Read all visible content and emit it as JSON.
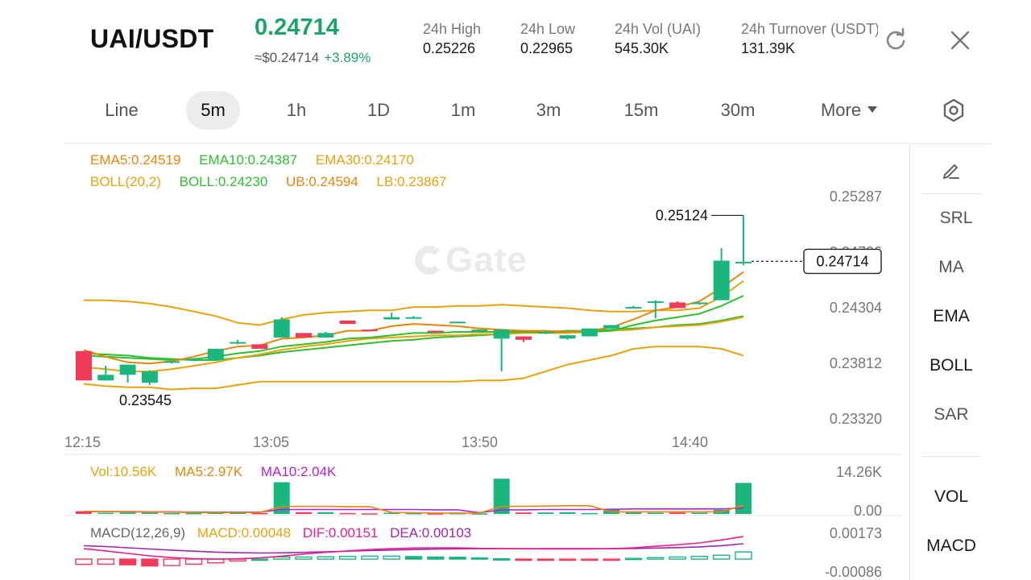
{
  "header": {
    "pair": "UAI/USDT",
    "price": "0.24714",
    "usd_price": "≈$0.24714",
    "change": "+3.89%",
    "stats": [
      {
        "label": "24h  High",
        "value": "0.25226"
      },
      {
        "label": "24h  Low",
        "value": "0.22965"
      },
      {
        "label": "24h  Vol (UAI)",
        "value": "545.30K"
      },
      {
        "label": "24h  Turnover (USDT)",
        "value": "131.39K"
      }
    ],
    "icons": {
      "refresh": "refresh-icon",
      "close": "close-icon"
    }
  },
  "tabs": {
    "items": [
      "Line",
      "5m",
      "1h",
      "1D",
      "1m",
      "3m",
      "15m",
      "30m",
      "More"
    ],
    "active": "5m",
    "settings_icon": "hexagon-settings-icon"
  },
  "legends": {
    "ema": {
      "ema5": "EMA5:0.24519",
      "ema10": "EMA10:0.24387",
      "ema30": "EMA30:0.24170"
    },
    "boll": {
      "params": "BOLL(20,2)",
      "mid": "BOLL:0.24230",
      "ub": "UB:0.24594",
      "lb": "LB:0.23867"
    },
    "vol": {
      "vol": "Vol:10.56K",
      "ma5": "MA5:2.97K",
      "ma10": "MA10:2.04K"
    },
    "macd": {
      "params": "MACD(12,26,9)",
      "macd": "MACD:0.00048",
      "dif": "DIF:0.00151",
      "dea": "DEA:0.00103"
    }
  },
  "side_toolbar": {
    "draw_icon": "pencil-icon",
    "items": [
      "SRL",
      "MA",
      "EMA",
      "BOLL",
      "SAR",
      "VOL",
      "MACD"
    ]
  },
  "watermark": "Gate",
  "colors": {
    "up": "#19b77e",
    "down": "#f23a5a",
    "ema5": "#e8860b",
    "ema10": "#2fbf2f",
    "ema30": "#e8a30b",
    "boll_mid": "#2fbf2f",
    "boll_band": "#e8a30b",
    "ma5": "#e8860b",
    "ma10": "#b620d6",
    "dif": "#e91e8c",
    "dea": "#9c27b0"
  },
  "chart_data": {
    "type": "candlestick",
    "y_ticks": [
      "0.25287",
      "0.24796",
      "0.24304",
      "0.23812",
      "0.23320"
    ],
    "x_ticks": [
      "12:15",
      "13:05",
      "13:50",
      "14:40"
    ],
    "ylim": [
      0.2332,
      0.25287
    ],
    "last_price": "0.24714",
    "high_label": "0.25124",
    "low_label": "0.23545",
    "candles": [
      {
        "o": 0.2392,
        "h": 0.2392,
        "l": 0.2366,
        "c": 0.2366
      },
      {
        "o": 0.2366,
        "h": 0.2379,
        "l": 0.2366,
        "c": 0.2371
      },
      {
        "o": 0.2371,
        "h": 0.238,
        "l": 0.2364,
        "c": 0.238
      },
      {
        "o": 0.2364,
        "h": 0.2375,
        "l": 0.2362,
        "c": 0.2374
      },
      {
        "o": 0.2382,
        "h": 0.2383,
        "l": 0.2381,
        "c": 0.2383
      },
      {
        "o": 0.2384,
        "h": 0.2385,
        "l": 0.2383,
        "c": 0.2385
      },
      {
        "o": 0.2384,
        "h": 0.2394,
        "l": 0.2384,
        "c": 0.2394
      },
      {
        "o": 0.24,
        "h": 0.2402,
        "l": 0.2398,
        "c": 0.24
      },
      {
        "o": 0.2398,
        "h": 0.2398,
        "l": 0.2394,
        "c": 0.2394
      },
      {
        "o": 0.2404,
        "h": 0.2422,
        "l": 0.2404,
        "c": 0.242
      },
      {
        "o": 0.2408,
        "h": 0.2408,
        "l": 0.2404,
        "c": 0.2404
      },
      {
        "o": 0.2404,
        "h": 0.2409,
        "l": 0.2404,
        "c": 0.2408
      },
      {
        "o": 0.2419,
        "h": 0.2419,
        "l": 0.2416,
        "c": 0.2416
      },
      {
        "o": 0.2411,
        "h": 0.2411,
        "l": 0.241,
        "c": 0.241
      },
      {
        "o": 0.242,
        "h": 0.2426,
        "l": 0.242,
        "c": 0.2422
      },
      {
        "o": 0.2422,
        "h": 0.2423,
        "l": 0.2421,
        "c": 0.2422
      },
      {
        "o": 0.241,
        "h": 0.241,
        "l": 0.2409,
        "c": 0.2409
      },
      {
        "o": 0.2418,
        "h": 0.2418,
        "l": 0.2417,
        "c": 0.2418
      },
      {
        "o": 0.2411,
        "h": 0.2411,
        "l": 0.241,
        "c": 0.2411
      },
      {
        "o": 0.2403,
        "h": 0.2411,
        "l": 0.2374,
        "c": 0.2411
      },
      {
        "o": 0.2405,
        "h": 0.2405,
        "l": 0.24,
        "c": 0.2402
      },
      {
        "o": 0.2408,
        "h": 0.241,
        "l": 0.2407,
        "c": 0.2409
      },
      {
        "o": 0.2403,
        "h": 0.2406,
        "l": 0.2402,
        "c": 0.2406
      },
      {
        "o": 0.2405,
        "h": 0.2412,
        "l": 0.2405,
        "c": 0.2412
      },
      {
        "o": 0.2412,
        "h": 0.2415,
        "l": 0.2412,
        "c": 0.2415
      },
      {
        "o": 0.2431,
        "h": 0.2432,
        "l": 0.243,
        "c": 0.2431
      },
      {
        "o": 0.2436,
        "h": 0.2437,
        "l": 0.2421,
        "c": 0.2436
      },
      {
        "o": 0.2435,
        "h": 0.2436,
        "l": 0.243,
        "c": 0.243
      },
      {
        "o": 0.2434,
        "h": 0.2435,
        "l": 0.2433,
        "c": 0.2435
      },
      {
        "o": 0.2437,
        "h": 0.2483,
        "l": 0.2437,
        "c": 0.2472
      },
      {
        "o": 0.2471,
        "h": 0.2512,
        "l": 0.2468,
        "c": 0.2471
      }
    ],
    "ema5": [
      0.2393,
      0.2387,
      0.2382,
      0.2381,
      0.2383,
      0.2387,
      0.2392,
      0.2396,
      0.2397,
      0.2403,
      0.2404,
      0.2406,
      0.241,
      0.241,
      0.2414,
      0.2416,
      0.2415,
      0.2414,
      0.2412,
      0.2411,
      0.241,
      0.241,
      0.2409,
      0.241,
      0.2413,
      0.242,
      0.2428,
      0.2431,
      0.2436,
      0.2448,
      0.2462
    ],
    "ema10": [
      0.2388,
      0.2387,
      0.2386,
      0.2385,
      0.2384,
      0.2385,
      0.2387,
      0.239,
      0.2392,
      0.2396,
      0.2398,
      0.24,
      0.2403,
      0.2404,
      0.2406,
      0.2408,
      0.2408,
      0.2409,
      0.2409,
      0.2409,
      0.2409,
      0.2409,
      0.2409,
      0.2409,
      0.241,
      0.2415,
      0.2419,
      0.2422,
      0.2425,
      0.2432,
      0.2441
    ],
    "ema30": [
      0.2378,
      0.2376,
      0.2374,
      0.2374,
      0.2376,
      0.2379,
      0.2382,
      0.2386,
      0.2389,
      0.2393,
      0.2396,
      0.2398,
      0.2401,
      0.2403,
      0.2404,
      0.2405,
      0.2406,
      0.2406,
      0.2407,
      0.2407,
      0.2408,
      0.2408,
      0.2408,
      0.2409,
      0.241,
      0.2411,
      0.2413,
      0.2414,
      0.2415,
      0.2418,
      0.2422
    ],
    "boll_mid": [
      0.239,
      0.2389,
      0.2388,
      0.2386,
      0.2385,
      0.2384,
      0.2384,
      0.2386,
      0.2388,
      0.2391,
      0.2393,
      0.2395,
      0.2397,
      0.2399,
      0.2401,
      0.2402,
      0.2404,
      0.2405,
      0.2406,
      0.2407,
      0.2408,
      0.2409,
      0.241,
      0.241,
      0.2411,
      0.2412,
      0.2413,
      0.2415,
      0.2416,
      0.2419,
      0.2423
    ],
    "boll_ub": [
      0.2437,
      0.2437,
      0.2436,
      0.2434,
      0.2431,
      0.2427,
      0.2423,
      0.2417,
      0.2415,
      0.242,
      0.2424,
      0.2426,
      0.2427,
      0.2428,
      0.2428,
      0.2431,
      0.2431,
      0.2432,
      0.2432,
      0.2433,
      0.2432,
      0.2431,
      0.243,
      0.2428,
      0.2427,
      0.2427,
      0.2428,
      0.2428,
      0.243,
      0.244,
      0.2454
    ],
    "boll_lb": [
      0.2363,
      0.2361,
      0.236,
      0.236,
      0.2358,
      0.2359,
      0.2359,
      0.2362,
      0.2365,
      0.2365,
      0.2365,
      0.2365,
      0.2365,
      0.2365,
      0.2365,
      0.2365,
      0.2365,
      0.2365,
      0.2366,
      0.2366,
      0.2368,
      0.2374,
      0.238,
      0.2384,
      0.2388,
      0.2394,
      0.2396,
      0.2396,
      0.2396,
      0.2394,
      0.2388
    ],
    "vol_max_label": "14.26K",
    "vol_zero_label": "0.00",
    "volume": [
      0.9,
      0.4,
      0.5,
      0.7,
      0.3,
      0.3,
      0.8,
      0.6,
      0.3,
      10.8,
      0.6,
      0.6,
      0.3,
      0.2,
      0.4,
      0.3,
      0.2,
      0.3,
      0.2,
      12.0,
      0.5,
      0.5,
      0.6,
      0.3,
      1.5,
      0.6,
      0.4,
      0.5,
      0.4,
      1.4,
      10.56
    ],
    "vol_ma5": [
      0.9,
      0.8,
      0.7,
      0.6,
      0.6,
      0.5,
      0.5,
      0.5,
      0.5,
      2.5,
      2.6,
      2.6,
      2.5,
      2.5,
      0.5,
      0.4,
      0.3,
      0.3,
      0.3,
      2.6,
      2.6,
      2.7,
      2.8,
      2.8,
      0.7,
      0.7,
      0.7,
      0.7,
      0.7,
      0.7,
      2.97
    ],
    "vol_ma10": [
      0.8,
      0.8,
      0.8,
      0.7,
      0.7,
      0.6,
      0.6,
      0.6,
      0.6,
      1.5,
      1.5,
      1.5,
      1.5,
      1.5,
      1.5,
      1.5,
      1.4,
      1.4,
      0.4,
      1.4,
      1.4,
      1.5,
      1.5,
      1.5,
      1.6,
      1.7,
      1.7,
      1.7,
      1.7,
      1.7,
      2.04
    ],
    "macd_top_label": "0.00173",
    "macd_bottom_label": "-0.00086",
    "macd_hist": [
      -0.00035,
      -0.00034,
      -0.00038,
      -0.00046,
      -0.00043,
      -0.00034,
      -0.00025,
      -0.00012,
      0.0,
      0.00014,
      0.00014,
      0.00016,
      0.00018,
      0.0002,
      0.0002,
      0.00017,
      0.00014,
      0.00012,
      8e-05,
      2e-05,
      -3e-05,
      -6e-05,
      -4e-05,
      -4e-05,
      -2e-05,
      5e-05,
      0.0001,
      0.00014,
      0.00018,
      0.00026,
      0.00048
    ],
    "dif": [
      0.0007,
      0.00055,
      0.00038,
      0.00022,
      0.0001,
      3e-05,
      0.0,
      2e-05,
      8e-05,
      0.0002,
      0.00034,
      0.00045,
      0.00055,
      0.00064,
      0.0007,
      0.00074,
      0.00076,
      0.00075,
      0.00072,
      0.0007,
      0.00069,
      0.00068,
      0.00068,
      0.00068,
      0.0007,
      0.00076,
      0.00086,
      0.00096,
      0.00108,
      0.00128,
      0.00151
    ],
    "dea": [
      0.0009,
      0.00084,
      0.00076,
      0.00068,
      0.0006,
      0.00053,
      0.00047,
      0.00043,
      0.00041,
      0.00042,
      0.00045,
      0.00049,
      0.00053,
      0.00057,
      0.00061,
      0.00064,
      0.00067,
      0.00069,
      0.0007,
      0.0007,
      0.0007,
      0.0007,
      0.0007,
      0.0007,
      0.0007,
      0.00071,
      0.00074,
      0.00077,
      0.00082,
      0.0009,
      0.00103
    ]
  }
}
